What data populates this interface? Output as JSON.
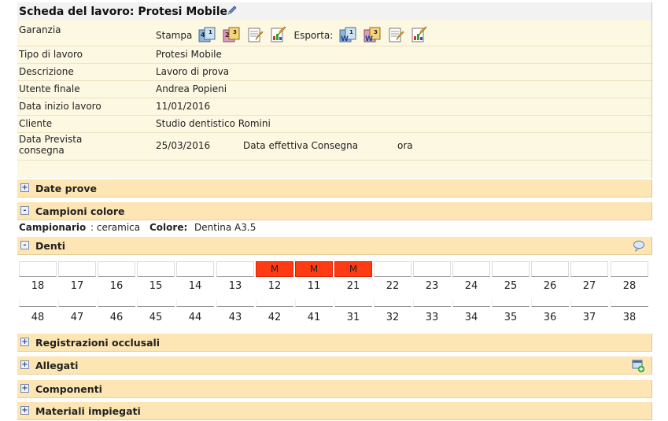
{
  "title": "Scheda del lavoro: Protesi Mobile",
  "fields": {
    "garanzia_label": "Garanzia",
    "stampa_label": "Stampa",
    "esporta_label": "Esporta:",
    "tipo_label": "Tipo di lavoro",
    "tipo_value": "Protesi Mobile",
    "descrizione_label": "Descrizione",
    "descrizione_value": "Lavoro di prova",
    "utente_label": "Utente finale",
    "utente_value": "Andrea Popieni",
    "data_inizio_label": "Data inizio lavoro",
    "data_inizio_value": "11/01/2016",
    "cliente_label": "Cliente",
    "cliente_value": "Studio dentistico Romini",
    "data_prevista_label_1": "Data Prevista",
    "data_prevista_label_2": "consegna",
    "data_prevista_value": "25/03/2016",
    "data_effettiva_label": "Data effettiva Consegna",
    "ora_label": "ora"
  },
  "sections": {
    "date_prove": "Date prove",
    "campioni_colore": "Campioni colore",
    "denti": "Denti",
    "registrazioni": "Registrazioni occlusali",
    "allegati": "Allegati",
    "componenti": "Componenti",
    "materiali": "Materiali impiegati"
  },
  "toggles": {
    "plus": "+",
    "minus": "-"
  },
  "campioni": {
    "campionario_label": "Campionario",
    "campionario_value": ": ceramica",
    "colore_label": "Colore:",
    "colore_value": "Dentina A3.5"
  },
  "teeth": {
    "upper": [
      "18",
      "17",
      "16",
      "15",
      "14",
      "13",
      "12",
      "11",
      "21",
      "22",
      "23",
      "24",
      "25",
      "26",
      "27",
      "28"
    ],
    "upper_marks": [
      "",
      "",
      "",
      "",
      "",
      "",
      "M",
      "M",
      "M",
      "",
      "",
      "",
      "",
      "",
      "",
      ""
    ],
    "lower": [
      "48",
      "47",
      "46",
      "45",
      "44",
      "43",
      "42",
      "41",
      "31",
      "32",
      "33",
      "34",
      "35",
      "36",
      "37",
      "38"
    ]
  },
  "colors": {
    "section_header": "#fde6b3",
    "info_background": "#fdf8e2",
    "mark": "#ff3b14"
  },
  "icons": {
    "print": [
      "print-4-1-icon",
      "print-2-3-icon",
      "print-doc-icon",
      "print-chart-icon"
    ],
    "export": [
      "export-word-4-1-icon",
      "export-word-2-3-icon",
      "export-doc-icon",
      "export-chart-icon"
    ]
  }
}
